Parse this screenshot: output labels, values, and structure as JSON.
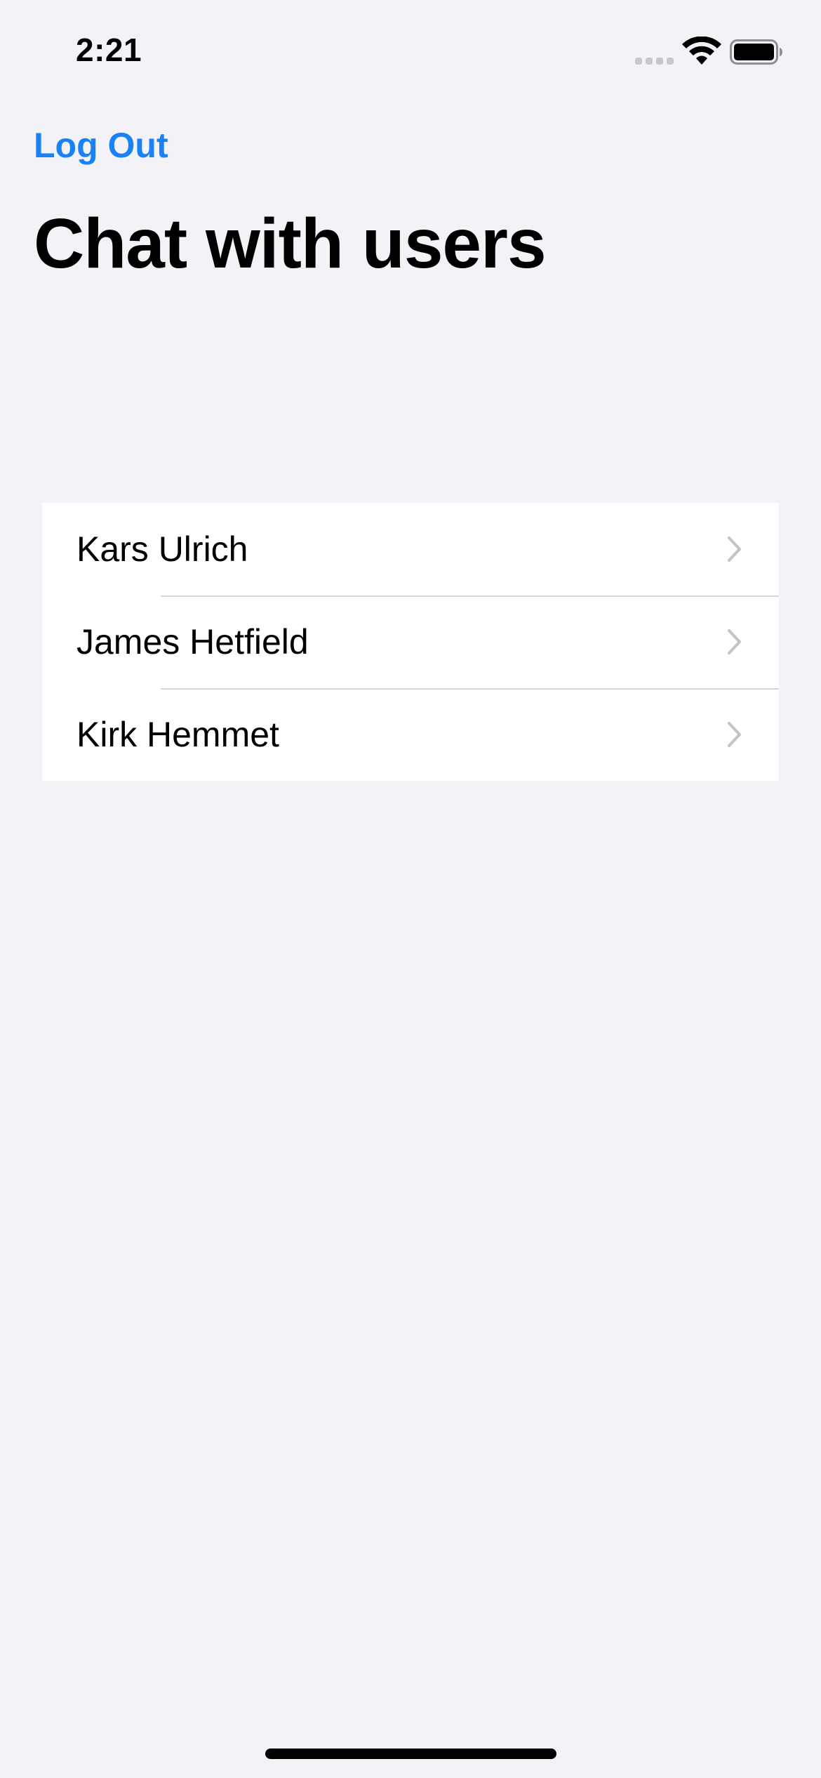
{
  "status_bar": {
    "time": "2:21",
    "icons": [
      "signal-icon",
      "wifi-icon",
      "battery-icon"
    ]
  },
  "nav": {
    "logout_label": "Log Out",
    "title": "Chat with users"
  },
  "users": [
    {
      "name": "Kars Ulrich"
    },
    {
      "name": "James Hetfield"
    },
    {
      "name": "Kirk Hemmet"
    }
  ],
  "colors": {
    "accent": "#1a82f7",
    "background": "#f2f2f7",
    "row_background": "#ffffff",
    "separator": "#d5d5d9",
    "chevron": "#c4c4c7"
  }
}
